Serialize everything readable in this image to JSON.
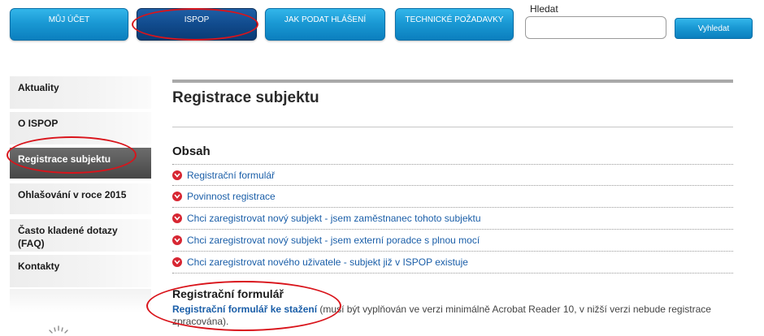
{
  "nav": {
    "items": [
      {
        "label": "MŮJ ÚČET",
        "active": false
      },
      {
        "label": "ISPOP",
        "active": true
      },
      {
        "label": "JAK PODAT HLÁŠENÍ",
        "active": false
      },
      {
        "label": "TECHNICKÉ POŽADAVKY",
        "active": false
      }
    ]
  },
  "search": {
    "label": "Hledat",
    "value": "",
    "button_label": "Vyhledat"
  },
  "sidebar": {
    "items": [
      {
        "label": "Aktuality",
        "active": false
      },
      {
        "label": "O ISPOP",
        "active": false
      },
      {
        "label": "Registrace subjektu",
        "active": true
      },
      {
        "label": "Ohlašování v roce 2015",
        "active": false
      },
      {
        "label": "Často kladené dotazy (FAQ)",
        "active": false
      },
      {
        "label": "Kontakty",
        "active": false
      }
    ]
  },
  "main": {
    "title": "Registrace subjektu",
    "toc_heading": "Obsah",
    "toc": [
      "Registrační formulář",
      "Povinnost registrace",
      "Chci zaregistrovat nový subjekt - jsem zaměstnanec tohoto subjektu",
      "Chci zaregistrovat nový subjekt - jsem externí poradce s plnou mocí",
      "Chci zaregistrovat nového uživatele - subjekt již v ISPOP existuje"
    ],
    "section": {
      "heading": "Registrační formulář",
      "link_text": "Registrační formulář ke stažení",
      "description": " (musí být vyplňován ve verzi minimálně Acrobat Reader 10, v nižší verzi nebude registrace zpracována)."
    }
  },
  "colors": {
    "nav_blue": "#1a99d4",
    "nav_active": "#114b8d",
    "link": "#1a5ea8",
    "bullet": "#d72632",
    "annotation": "#d9141b"
  }
}
